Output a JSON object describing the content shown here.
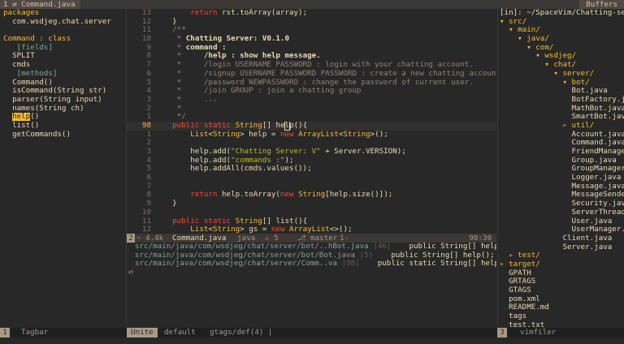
{
  "tabline": {
    "active_tab": "1 ⇄ Command.java",
    "buffers_label": "Buffers"
  },
  "tagbar": {
    "lines": [
      {
        "text": "packages",
        "cls": "tg-head",
        "indent": 0
      },
      {
        "text": "  com.wsdjeg.chat.server",
        "cls": "",
        "indent": 0
      },
      {
        "text": "",
        "cls": "",
        "indent": 0
      },
      {
        "text": "Command : class",
        "cls": "tg-head",
        "indent": 0
      },
      {
        "text": "   [fields]",
        "cls": "tg-field",
        "indent": 0
      },
      {
        "text": "  SPLIT",
        "cls": "",
        "indent": 0
      },
      {
        "text": "  cmds",
        "cls": "",
        "indent": 0
      },
      {
        "text": "   [methods]",
        "cls": "tg-field",
        "indent": 0
      },
      {
        "text": "  Command()",
        "cls": "",
        "indent": 0
      },
      {
        "text": "  isCommand(String str)",
        "cls": "",
        "indent": 0
      },
      {
        "text": "  parser(String input)",
        "cls": "",
        "indent": 0
      },
      {
        "text": "  names(String ch)",
        "cls": "",
        "indent": 0
      },
      {
        "text": "  help()",
        "cls": "sel",
        "indent": 0
      },
      {
        "text": "  list()",
        "cls": "",
        "indent": 0
      },
      {
        "text": "  getCommands()",
        "cls": "",
        "indent": 0
      }
    ],
    "status_label": "Tagbar"
  },
  "editor": {
    "lines": [
      {
        "n": "13",
        "html": "        <span class='kw'>return</span> rst.toArray(array);"
      },
      {
        "n": "12",
        "html": "    }"
      },
      {
        "n": "11",
        "html": "    <span class='cm'>/**</span>"
      },
      {
        "n": "10",
        "html": "     <span class='cm'>*</span> <span class='cmb'>Chatting Server: V0.1.0</span>"
      },
      {
        "n": "9",
        "html": "     <span class='cm'>*</span> <span class='cmb'>command :</span>"
      },
      {
        "n": "8",
        "html": "     <span class='cm'>*</span>     <span class='cmb'>/help : show help message.</span>"
      },
      {
        "n": "7",
        "html": "     <span class='cm'>*     /login USERNAME PASSWORD : login with your chatting account.</span>"
      },
      {
        "n": "6",
        "html": "     <span class='cm'>*     /signup USERNAME PASSWORD PASSWORD : create a new chatting account.</span>"
      },
      {
        "n": "5",
        "html": "     <span class='cm'>*     /password NEWPASSWORD : change the password of current user.</span>"
      },
      {
        "n": "4",
        "html": "     <span class='cm'>*     /join GROUP : join a chatting group</span>"
      },
      {
        "n": "3",
        "html": "     <span class='cm'>*     ...</span>"
      },
      {
        "n": "2",
        "html": "     <span class='cm'>*</span>"
      },
      {
        "n": "1",
        "html": "     <span class='cm'>*/</span>"
      },
      {
        "n": "98",
        "html": "    <span class='kw'>public</span> <span class='kw'>static</span> <span class='ty'>String</span>[] he<span class='cursor'>l</span>p(){",
        "cur": true
      },
      {
        "n": "1",
        "html": "        <span class='ty'>List</span>&lt;<span class='ty'>String</span>&gt; help = <span class='kw'>new</span> <span class='ty'>ArrayList</span>&lt;<span class='ty'>String</span>&gt;();"
      },
      {
        "n": "2",
        "html": ""
      },
      {
        "n": "3",
        "html": "        help.add(<span class='st'>\"Chatting Server: V\"</span> + Server.VERSION);"
      },
      {
        "n": "4",
        "html": "        help.add(<span class='st'>\"commands :\"</span>);"
      },
      {
        "n": "5",
        "html": "        help.addAll(cmds.values());"
      },
      {
        "n": "6",
        "html": ""
      },
      {
        "n": "7",
        "html": ""
      },
      {
        "n": "8",
        "html": "        <span class='kw'>return</span> help.toArray(<span class='kw'>new</span> <span class='ty'>String</span>[help.size()]);"
      },
      {
        "n": "9",
        "html": "    }"
      },
      {
        "n": "10",
        "html": ""
      },
      {
        "n": "11",
        "html": "    <span class='kw'>public</span> <span class='kw'>static</span> <span class='ty'>String</span>[] list(){"
      },
      {
        "n": "12",
        "html": "        <span class='ty'>List</span>&lt;<span class='ty'>String</span>&gt; gs = <span class='kw'>new</span> <span class='ty'>ArrayList</span>&lt;&gt;();"
      }
    ],
    "status": {
      "mode": "2",
      "size": "~ 4.4k",
      "file": "Command.java",
      "filetype": "java",
      "branch_info": "⚠ 5",
      "git": "⎇ master",
      "enc": "1-",
      "position": "98:30"
    }
  },
  "quickfix": {
    "rows": [
      {
        "path": "src/main/java/com/wsdjeg/chat/server/bot/..hBot.java",
        "lnum": "|46|",
        "text": "    public String[] help(){"
      },
      {
        "path": "src/main/java/com/wsdjeg/chat/server/bot/Bot.java",
        "lnum": "|5|",
        "text": "    public String[] help();"
      },
      {
        "path": "src/main/java/com/wsdjeg/chat/server/Comm..va",
        "lnum": "|98|",
        "text": "    public static String[] help(){"
      }
    ],
    "prompt": "⏎",
    "status_mode": "Unite",
    "status_source": "default",
    "status_info": "gtags/def(4)  |"
  },
  "vimfiler": {
    "header": "[in]: ~/SpaceVim/Chatting-serv",
    "lines": [
      {
        "text": "▾ src/",
        "cls": "dir"
      },
      {
        "text": "  ▾ main/",
        "cls": "dir"
      },
      {
        "text": "    ▾ java/",
        "cls": "dir"
      },
      {
        "text": "      ▾ com/",
        "cls": "dir"
      },
      {
        "text": "        ▾ wsdjeg/",
        "cls": "dir"
      },
      {
        "text": "          ▾ chat/",
        "cls": "dir"
      },
      {
        "text": "            ▾ server/",
        "cls": "dir"
      },
      {
        "text": "              ▾ bot/",
        "cls": "dir"
      },
      {
        "text": "                Bot.java",
        "cls": "file"
      },
      {
        "text": "                BotFactory.java",
        "cls": "file"
      },
      {
        "text": "                MathBot.java",
        "cls": "file"
      },
      {
        "text": "                SmartBot.java",
        "cls": "file"
      },
      {
        "text": "              ▹ util/",
        "cls": "dir"
      },
      {
        "text": "                Account.java",
        "cls": "file"
      },
      {
        "text": "                Command.java",
        "cls": "file"
      },
      {
        "text": "                FriendManager.java",
        "cls": "file"
      },
      {
        "text": "                Group.java",
        "cls": "file"
      },
      {
        "text": "                GroupManager.java",
        "cls": "file"
      },
      {
        "text": "                Logger.java",
        "cls": "file"
      },
      {
        "text": "                Message.java",
        "cls": "file"
      },
      {
        "text": "                MessageSender.java",
        "cls": "file"
      },
      {
        "text": "                Security.java",
        "cls": "file"
      },
      {
        "text": "                ServerThread.java",
        "cls": "file"
      },
      {
        "text": "                User.java",
        "cls": "file"
      },
      {
        "text": "                UserManager.java",
        "cls": "file"
      },
      {
        "text": "              Client.java",
        "cls": "file"
      },
      {
        "text": "              Server.java",
        "cls": "file"
      },
      {
        "text": "  ▹ test/",
        "cls": "dir"
      },
      {
        "text": "▹ target/",
        "cls": "dir"
      },
      {
        "text": "  GPATH",
        "cls": "file"
      },
      {
        "text": "  GRTAGS",
        "cls": "file"
      },
      {
        "text": "  GTAGS",
        "cls": "file"
      },
      {
        "text": "  pom.xml",
        "cls": "file"
      },
      {
        "text": "  README.md",
        "cls": "file"
      },
      {
        "text": "  tags",
        "cls": "file"
      },
      {
        "text": "  test.txt",
        "cls": "file"
      }
    ],
    "status_label": "vimfiler"
  },
  "colors": {
    "bg": "#282828",
    "accent": "#fabd2f",
    "keyword": "#fb4934",
    "string": "#b8bb26",
    "comment": "#928374"
  }
}
